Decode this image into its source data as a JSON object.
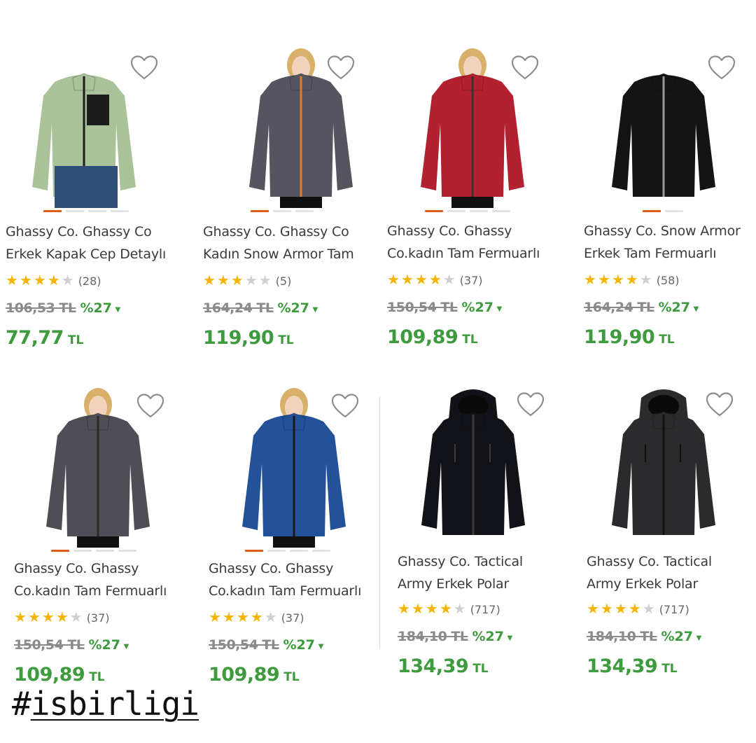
{
  "products": [
    {
      "title_line1": "Ghassy Co. Ghassy Co",
      "title_line2": "Erkek Kapak Cep Detaylı",
      "rating": 4,
      "reviews": "(28)",
      "old_price": "106,53 TL",
      "discount": "%27",
      "price": "77,77",
      "currency": "TL",
      "image": "green-fleece-jacket",
      "colors": {
        "body": "#a9c29a",
        "accent": "#1c1c1c"
      }
    },
    {
      "title_line1": "Ghassy Co. Ghassy Co",
      "title_line2": "Kadın Snow Armor Tam",
      "rating": 3,
      "reviews": "(5)",
      "old_price": "164,24 TL",
      "discount": "%27",
      "price": "119,90",
      "currency": "TL",
      "image": "grey-fleece-orange-zip",
      "colors": {
        "body": "#56555f",
        "accent": "#e07a2c"
      }
    },
    {
      "title_line1": "Ghassy Co. Ghassy",
      "title_line2": "Co.kadın Tam Fermuarlı",
      "rating": 4,
      "reviews": "(37)",
      "old_price": "150,54 TL",
      "discount": "%27",
      "price": "109,89",
      "currency": "TL",
      "image": "red-fleece-jacket",
      "colors": {
        "body": "#b32131",
        "accent": "#333333"
      }
    },
    {
      "title_line1": "Ghassy Co. Snow Armor",
      "title_line2": "Erkek Tam Fermuarlı",
      "rating": 4,
      "reviews": "(58)",
      "old_price": "164,24 TL",
      "discount": "%27",
      "price": "119,90",
      "currency": "TL",
      "image": "black-fleece-jacket",
      "colors": {
        "body": "#141414",
        "accent": "#9a9a9a"
      }
    },
    {
      "title_line1": "Ghassy Co. Ghassy",
      "title_line2": "Co.kadın Tam Fermuarlı",
      "rating": 4,
      "reviews": "(37)",
      "old_price": "150,54 TL",
      "discount": "%27",
      "price": "109,89",
      "currency": "TL",
      "image": "dark-grey-fleece-jacket",
      "colors": {
        "body": "#4f4d55",
        "accent": "#2a2a2a"
      }
    },
    {
      "title_line1": "Ghassy Co. Ghassy",
      "title_line2": "Co.kadın Tam Fermuarlı",
      "rating": 4,
      "reviews": "(37)",
      "old_price": "150,54 TL",
      "discount": "%27",
      "price": "109,89",
      "currency": "TL",
      "image": "blue-fleece-jacket",
      "colors": {
        "body": "#23529a",
        "accent": "#1a1a1a"
      }
    },
    {
      "title_line1": "Ghassy Co. Tactical",
      "title_line2": "Army Erkek Polar",
      "rating": 4,
      "reviews": "(717)",
      "old_price": "184,10 TL",
      "discount": "%27",
      "price": "134,39",
      "currency": "TL",
      "image": "black-hooded-tactical-fleece",
      "colors": {
        "body": "#121318",
        "accent": "#3a3a3a"
      }
    },
    {
      "title_line1": "Ghassy Co. Tactical",
      "title_line2": "Army Erkek Polar",
      "rating": 4,
      "reviews": "(717)",
      "old_price": "184,10 TL",
      "discount": "%27",
      "price": "134,39",
      "currency": "TL",
      "image": "charcoal-hooded-tactical-fleece",
      "colors": {
        "body": "#2b2b2d",
        "accent": "#111111"
      }
    }
  ],
  "hashtag": {
    "hash": "#",
    "word": "isbirligi"
  },
  "icons": {
    "favorite": "heart-outline-icon",
    "discount_arrow": "triangle-down-icon",
    "star": "star-icon"
  },
  "theme": {
    "price_green": "#3d9a3d",
    "star_gold": "#f5b400",
    "dot_active": "#e05a1a"
  }
}
